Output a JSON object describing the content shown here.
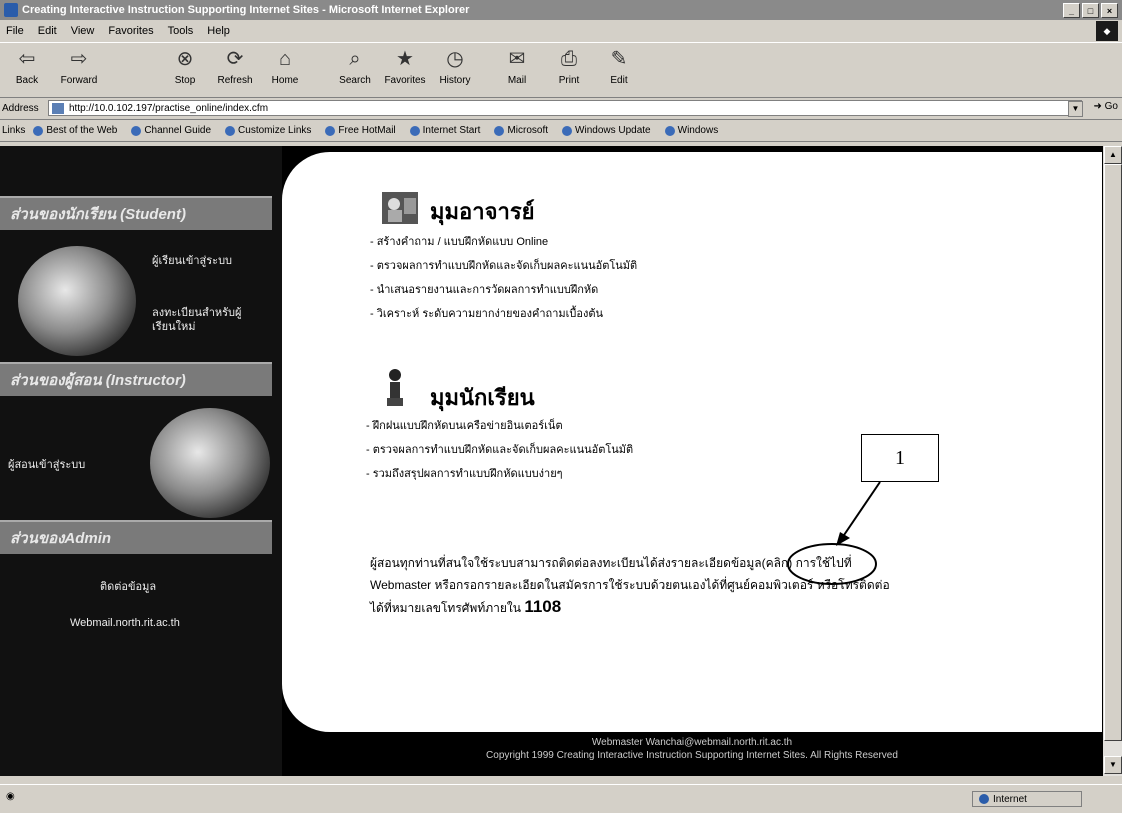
{
  "window": {
    "title": "Creating Interactive Instruction Supporting Internet Sites - Microsoft Internet Explorer"
  },
  "menu": [
    "File",
    "Edit",
    "View",
    "Favorites",
    "Tools",
    "Help"
  ],
  "toolbar": [
    {
      "label": "Back",
      "icon": "back-arrow-icon"
    },
    {
      "label": "Forward",
      "icon": "forward-arrow-icon"
    },
    {
      "label": "Stop",
      "icon": "stop-icon"
    },
    {
      "label": "Refresh",
      "icon": "refresh-icon"
    },
    {
      "label": "Home",
      "icon": "home-icon"
    },
    {
      "label": "Search",
      "icon": "search-icon"
    },
    {
      "label": "Favorites",
      "icon": "favorites-icon"
    },
    {
      "label": "History",
      "icon": "history-icon"
    },
    {
      "label": "Mail",
      "icon": "mail-icon"
    },
    {
      "label": "Print",
      "icon": "print-icon"
    },
    {
      "label": "Edit",
      "icon": "edit-icon"
    }
  ],
  "address": {
    "label": "Address",
    "url": "http://10.0.102.197/practise_online/index.cfm",
    "go": "Go"
  },
  "links": {
    "label": "Links",
    "items": [
      "Best of the Web",
      "Channel Guide",
      "Customize Links",
      "Free HotMail",
      "Internet Start",
      "Microsoft",
      "Windows Update",
      "Windows"
    ]
  },
  "sidebar": {
    "student_header": "ส่วนของนักเรียน (Student)",
    "student_links": [
      "ผู้เรียนเข้าสู่ระบบ",
      "ลงทะเบียนสำหรับผู้เรียนใหม่"
    ],
    "instructor_header": "ส่วนของผู้สอน (Instructor)",
    "instructor_links": [
      "ผู้สอนเข้าสู่ระบบ"
    ],
    "admin_header": "ส่วนของAdmin",
    "admin_links": [
      "ติดต่อข้อมูล",
      "Webmail.north.rit.ac.th"
    ]
  },
  "teacher": {
    "title": "มุมอาจารย์",
    "items": [
      "- สร้างคำถาม / แบบฝึกหัดแบบ Online",
      "- ตรวจผลการทำแบบฝึกหัดและจัดเก็บผลคะแนนอัตโนมัติ",
      "- นำเสนอรายงานและการวัดผลการทำแบบฝึกหัด",
      "- วิเคราะห์ ระดับความยากง่ายของคำถามเบื้องต้น"
    ]
  },
  "student": {
    "title": "มุมนักเรียน",
    "items": [
      "- ฝึกฝนแบบฝึกหัดบนเครือข่ายอินเตอร์เน็ต",
      "- ตรวจผลการทำแบบฝึกหัดและจัดเก็บผลคะแนนอัตโนมัติ",
      "- รวมถึงสรุปผลการทำแบบฝึกหัดแบบง่ายๆ"
    ]
  },
  "notice": {
    "line1_pre": "ผู้สอนทุกท่านที่สนใจใช้ระบบสามารถติดต่อลงทะเบียนได้",
    "line1_link": "ส่งรายละเอียดข้อมูล(คลิก)",
    "line1_post": " การใช้ไปที่",
    "line2": "Webmaster หรือกรอกรายละเอียดในสมัครการใช้ระบบด้วยตนเองได้ที่ศูนย์คอมพิวเตอร์ หรือโทรติดต่อ",
    "line3_pre": "ได้ที่หมายเลขโทรศัพท์ภายใน ",
    "line3_number": "1108"
  },
  "callout": {
    "label": "1"
  },
  "footer": {
    "line1": "Webmaster Wanchai@webmail.north.rit.ac.th",
    "line2": "Copyright 1999 Creating Interactive Instruction Supporting Internet Sites. All Rights Reserved"
  },
  "status": {
    "zone": "Internet"
  },
  "colors": {
    "title_bar": "#8a8a8a",
    "sidebar_header": "#7a7a7a",
    "callout_ellipse": "#000000"
  }
}
